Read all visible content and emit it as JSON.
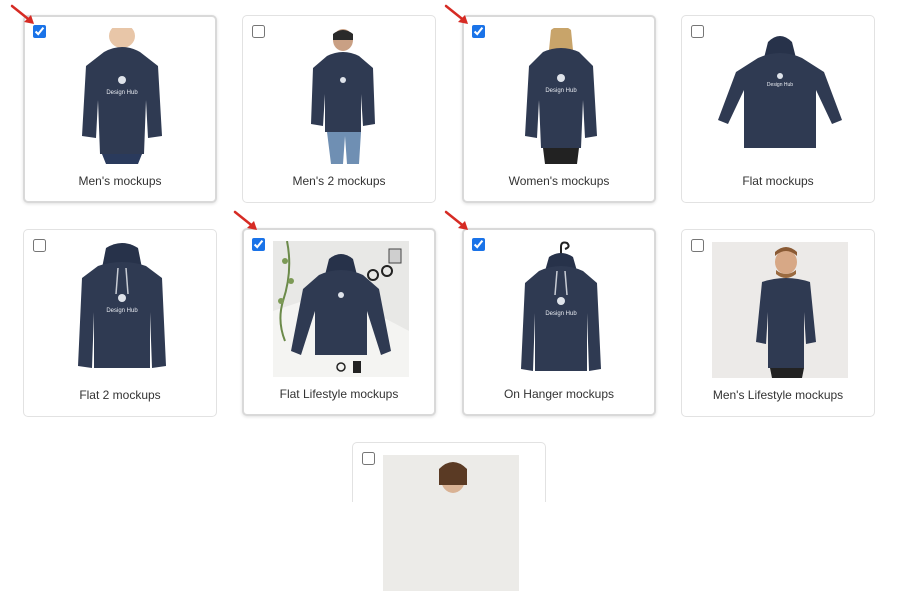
{
  "accent_color": "#1a73e8",
  "arrow_color": "#d62b24",
  "hoodie_color": "#2f3a52",
  "cards": [
    {
      "label": "Men's mockups",
      "checked": true,
      "image": "hoodie-model-male-icon"
    },
    {
      "label": "Men's 2 mockups",
      "checked": false,
      "image": "hoodie-model-male-pose-icon"
    },
    {
      "label": "Women's mockups",
      "checked": true,
      "image": "hoodie-model-female-icon"
    },
    {
      "label": "Flat mockups",
      "checked": false,
      "image": "hoodie-flat-arms-out-icon"
    },
    {
      "label": "Flat 2 mockups",
      "checked": false,
      "image": "hoodie-flat-icon"
    },
    {
      "label": "Flat Lifestyle mockups",
      "checked": true,
      "image": "hoodie-flat-lifestyle-icon"
    },
    {
      "label": "On Hanger mockups",
      "checked": true,
      "image": "hoodie-on-hanger-icon"
    },
    {
      "label": "Men's Lifestyle mockups",
      "checked": false,
      "image": "hoodie-lifestyle-male-icon"
    },
    {
      "label": "",
      "checked": false,
      "image": "hoodie-model-partial-icon"
    }
  ],
  "logo_text": "Design Hub"
}
